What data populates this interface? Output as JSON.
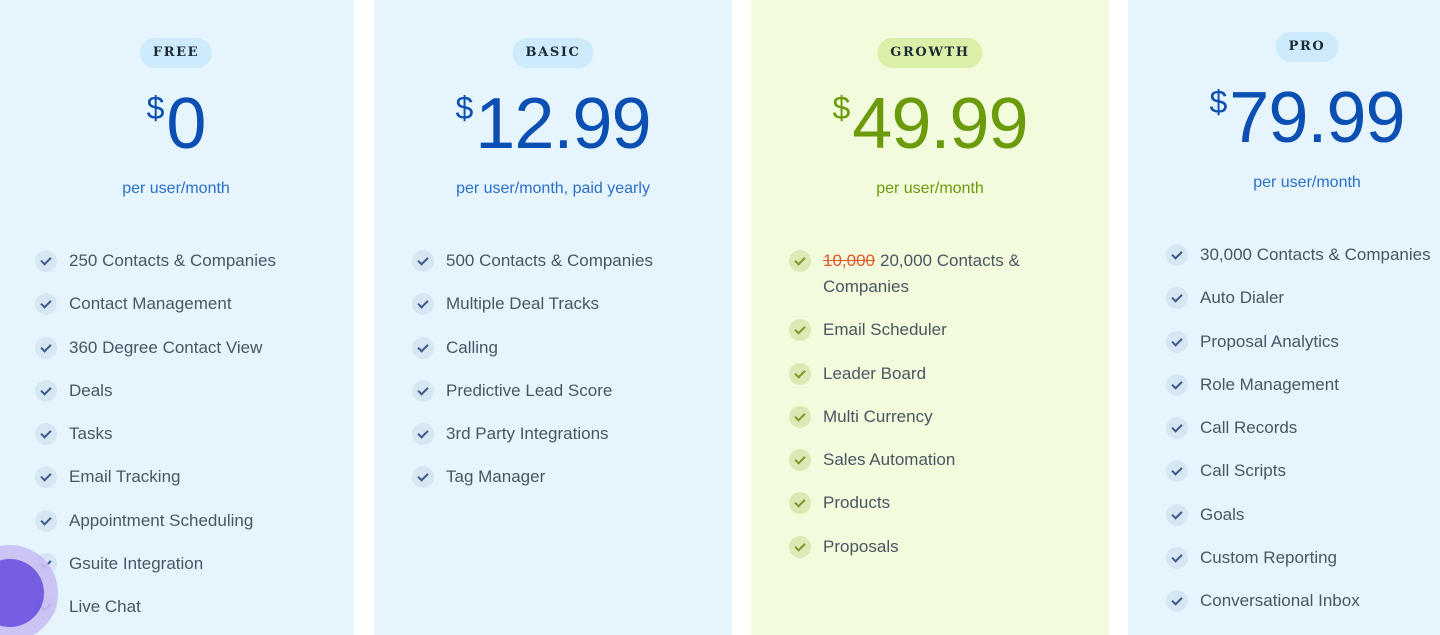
{
  "plans": [
    {
      "badge": "FREE",
      "currency": "$",
      "price": "0",
      "period": "per user/month",
      "features": [
        "250 Contacts & Companies",
        "Contact Management",
        "360 Degree Contact View",
        "Deals",
        "Tasks",
        "Email Tracking",
        "Appointment Scheduling",
        "Gsuite Integration",
        "Live Chat"
      ]
    },
    {
      "badge": "BASIC",
      "currency": "$",
      "price": "12.99",
      "period": "per user/month, paid yearly",
      "features": [
        "500 Contacts & Companies",
        "Multiple Deal Tracks",
        "Calling",
        "Predictive Lead Score",
        "3rd Party Integrations",
        "Tag Manager"
      ]
    },
    {
      "badge": "GROWTH",
      "currency": "$",
      "price": "49.99",
      "period": "per user/month",
      "first_feature_struck": "10,000",
      "first_feature_text": "20,000 Contacts & Companies",
      "features": [
        "Email Scheduler",
        "Leader Board",
        "Multi Currency",
        "Sales Automation",
        "Products",
        "Proposals"
      ]
    },
    {
      "badge": "PRO",
      "currency": "$",
      "price": "79.99",
      "period": "per user/month",
      "features": [
        "30,000 Contacts & Companies",
        "Auto Dialer",
        "Proposal Analytics",
        "Role Management",
        "Call Records",
        "Call Scripts",
        "Goals",
        "Custom Reporting",
        "Conversational Inbox"
      ]
    }
  ],
  "colors": {
    "card_bg": "#e6f5fd",
    "growth_bg": "#f2fbdc",
    "price_blue": "#0b4fb3",
    "price_green": "#6b9a0b",
    "strike_red": "#e2572a",
    "feature_text": "#4a5563"
  },
  "icons": {
    "feature_check": "check-icon"
  }
}
